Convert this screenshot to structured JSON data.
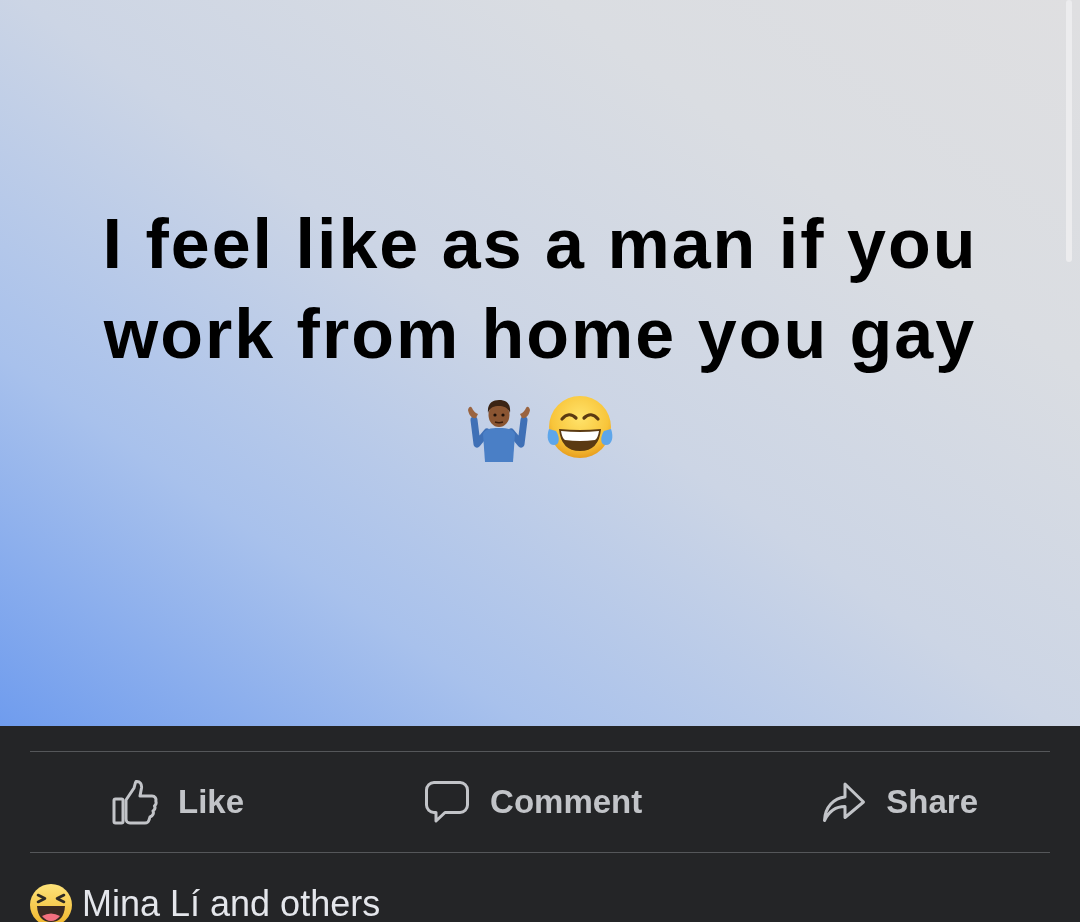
{
  "post": {
    "text": "I feel like as a man if you work from home you gay"
  },
  "actions": [
    {
      "label": "Like",
      "kind": "like"
    },
    {
      "label": "Comment",
      "kind": "comment"
    },
    {
      "label": "Share",
      "kind": "share"
    }
  ],
  "reactions": {
    "summary": "Mina Lí and others"
  }
}
